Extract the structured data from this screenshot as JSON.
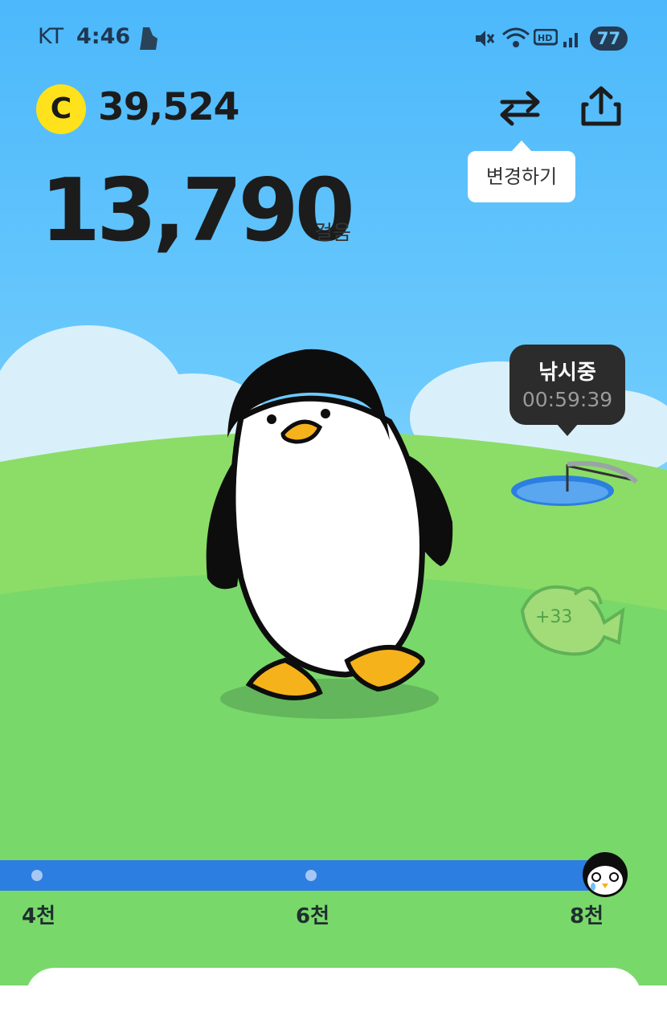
{
  "status_bar": {
    "carrier": "KT",
    "time": "4:46",
    "battery": "77",
    "icons": [
      "running-shoe-icon",
      "mute-icon",
      "wifi-icon",
      "hd-voice-icon",
      "signal-icon",
      "battery-icon"
    ]
  },
  "header": {
    "coin_symbol": "C",
    "coin_amount": "39,524",
    "tooltip": "변경하기",
    "icons": [
      "swap-icon",
      "share-icon"
    ]
  },
  "steps": {
    "count": "13,790",
    "unit": "걸음"
  },
  "fishing": {
    "status": "낚시중",
    "timer": "00:59:39"
  },
  "progress": {
    "ticks": [
      "4천",
      "6천",
      "8천"
    ],
    "current_steps": 13790
  },
  "colors": {
    "sky": "#4cb8fb",
    "grass": "#79d86a",
    "coin": "#ffe21b",
    "progress": "#2c7ee0"
  }
}
